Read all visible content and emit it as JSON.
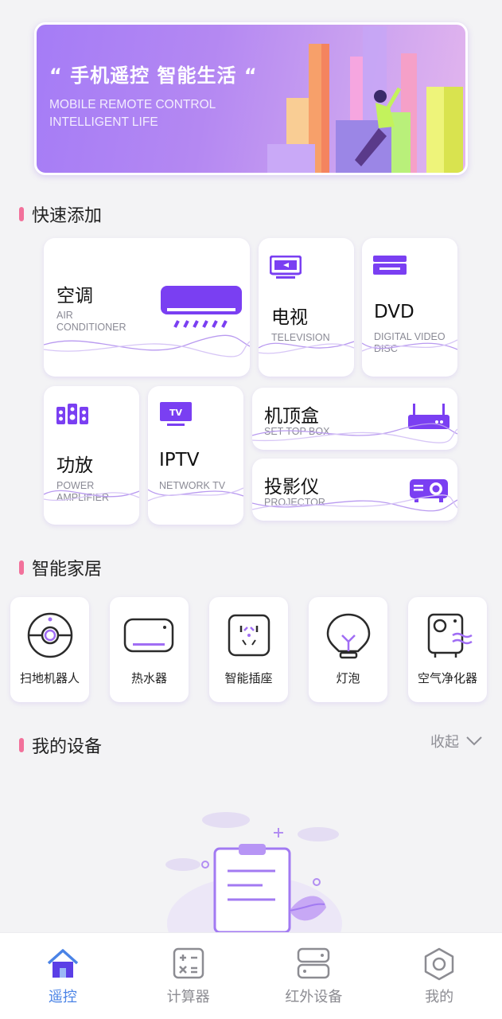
{
  "banner": {
    "slogan": "“ 手机遥控 智能生活 “",
    "subtitle_line1": "MOBILE REMOTE CONTROL",
    "subtitle_line2": "INTELLIGENT LIFE"
  },
  "quick_add": {
    "title": "快速添加",
    "items": [
      {
        "cn": "空调",
        "en": "AIR CONDITIONER",
        "icon": "air-conditioner-icon"
      },
      {
        "cn": "电视",
        "en": "TELEVISION",
        "icon": "tv-icon"
      },
      {
        "cn": "DVD",
        "en": "DIGITAL VIDEO DISC",
        "icon": "dvd-icon"
      },
      {
        "cn": "功放",
        "en": "POWER AMPLIFIER",
        "icon": "speaker-icon"
      },
      {
        "cn": "IPTV",
        "en": "NETWORK TV",
        "icon": "iptv-icon",
        "badge": "TV"
      },
      {
        "cn": "机顶盒",
        "en": "SET TOP BOX",
        "icon": "router-icon"
      },
      {
        "cn": "投影仪",
        "en": "PROJECTOR",
        "icon": "projector-icon"
      }
    ]
  },
  "smart_home": {
    "title": "智能家居",
    "items": [
      {
        "label": "扫地机器人",
        "icon": "robot-vacuum-icon"
      },
      {
        "label": "热水器",
        "icon": "water-heater-icon"
      },
      {
        "label": "智能插座",
        "icon": "smart-socket-icon"
      },
      {
        "label": "灯泡",
        "icon": "light-bulb-icon"
      },
      {
        "label": "空气净化器",
        "icon": "air-purifier-icon"
      }
    ]
  },
  "my_devices": {
    "title": "我的设备",
    "collapse_label": "收起"
  },
  "bottom_nav": {
    "items": [
      {
        "label": "遥控",
        "icon": "home-icon",
        "active": true
      },
      {
        "label": "计算器",
        "icon": "calculator-icon",
        "active": false
      },
      {
        "label": "红外设备",
        "icon": "infrared-device-icon",
        "active": false
      },
      {
        "label": "我的",
        "icon": "hexagon-icon",
        "active": false
      }
    ]
  },
  "colors": {
    "accent": "#7a3ff2",
    "section_bar": "#f2719b",
    "active_nav": "#4a83e6"
  }
}
